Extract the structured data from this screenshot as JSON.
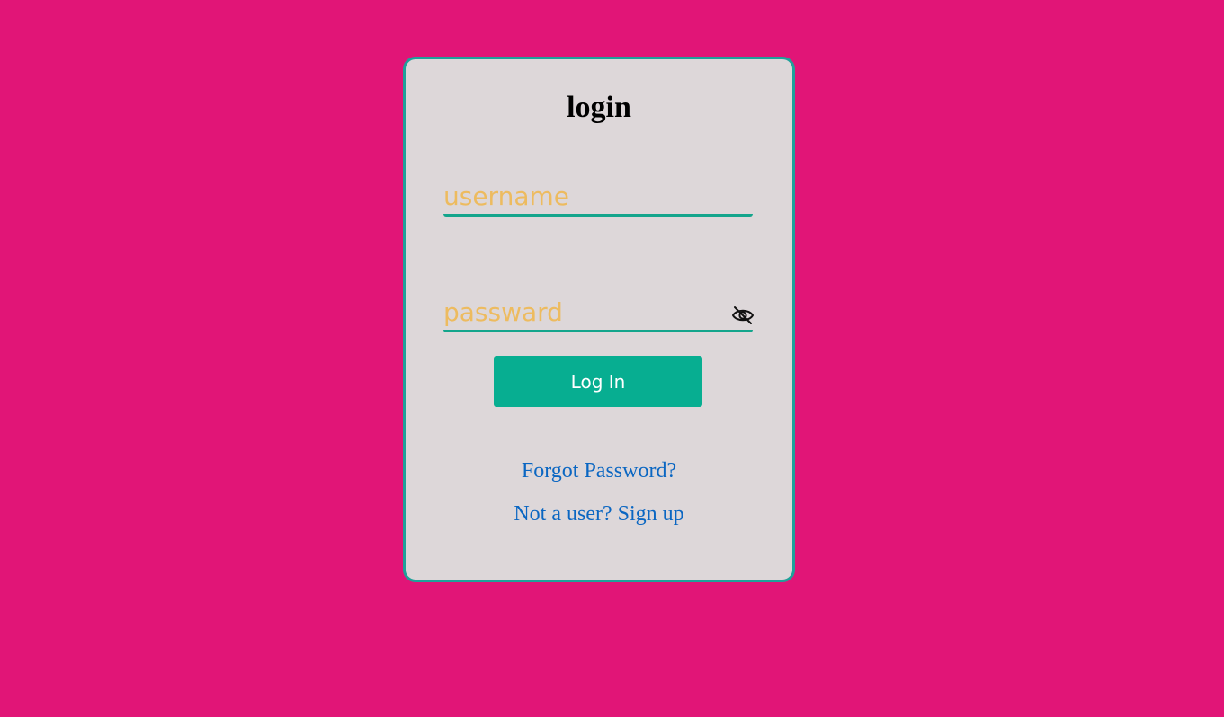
{
  "colors": {
    "page_background": "#E11577",
    "card_background": "#DDD7D9",
    "card_border": "#1FA19A",
    "field_underline": "#14A58C",
    "placeholder": "#EDBB5F",
    "button_background": "#07AE91",
    "button_text": "#FFFFFF",
    "link": "#0A66C2"
  },
  "login_form": {
    "title": "login",
    "username": {
      "value": "",
      "placeholder": "username"
    },
    "password": {
      "value": "",
      "placeholder": "passward",
      "toggle_icon": "eye-slash-icon"
    },
    "submit_label": "Log In",
    "forgot_password_label": "Forgot Password?",
    "signup_label": "Not a user? Sign up"
  }
}
